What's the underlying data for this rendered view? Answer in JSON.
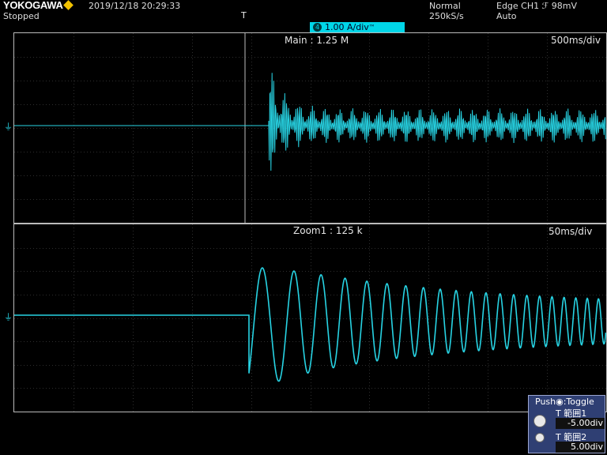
{
  "header": {
    "brand": "YOKOGAWA",
    "status": "Stopped",
    "datetime": "2019/12/18  20:29:33",
    "acq_mode": "Normal",
    "sample_rate": "250kS/s",
    "trigger": "Edge CH1  ℱ  98mV",
    "trigger_mode": "Auto",
    "trigger_marker": "T"
  },
  "scale": {
    "channel": "4",
    "vdiv": "1.00 A/div",
    "suffix": "™"
  },
  "main_pane": {
    "title": "Main : 1.25 M",
    "timebase": "500ms/div",
    "ground_marker": "⏚"
  },
  "zoom_pane": {
    "title": "Zoom1 : 125 k",
    "timebase": "50ms/div",
    "ground_marker": "⏚"
  },
  "control": {
    "title": "Push◉:Toggle",
    "range1_label": "T  範囲1",
    "range1_value": "-5.00div",
    "range2_label": "T  範囲2",
    "range2_value": "5.00div"
  },
  "colors": {
    "trace": "#27d3e3",
    "grid": "#2e2e2e",
    "scale_bar": "#00d6e8",
    "control_bg": "#2f3f73"
  }
}
